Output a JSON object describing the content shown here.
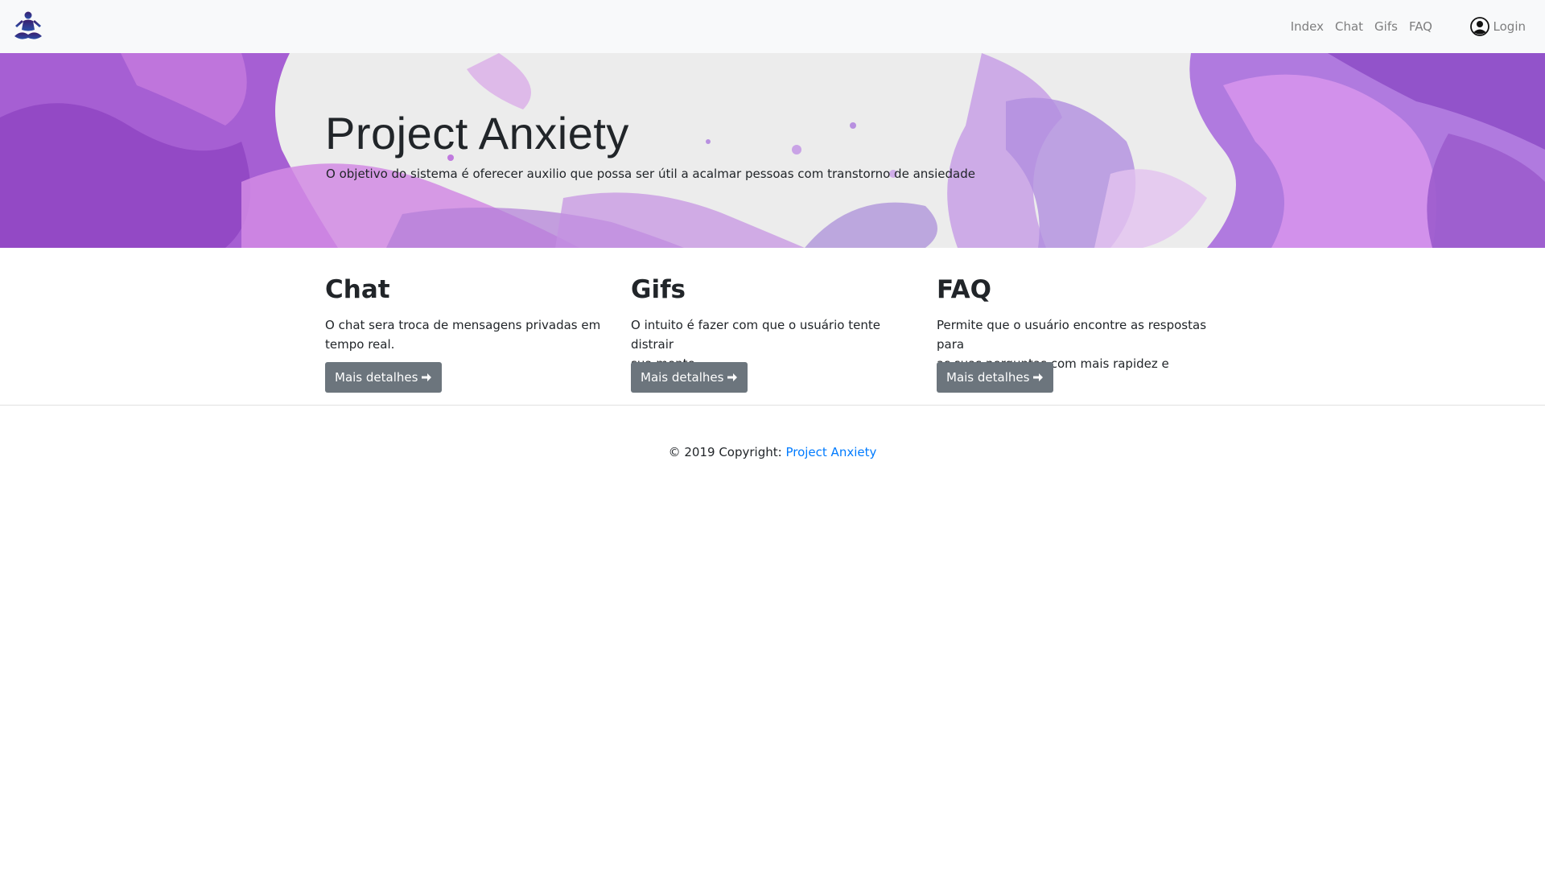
{
  "navbar": {
    "brand_icon": "meditation-person-icon",
    "links": [
      "Index",
      "Chat",
      "Gifs",
      "FAQ"
    ],
    "login_label": "Login",
    "login_icon": "user-circle-icon"
  },
  "hero": {
    "title": "Project Anxiety",
    "lead": "O objetivo do sistema é oferecer auxilio que possa ser útil a acalmar pessoas com transtorno de ansiedade",
    "palette": [
      "#9b59d0",
      "#c66ce0",
      "#b48ee0",
      "#d9a7ea"
    ]
  },
  "features": [
    {
      "title": "Chat",
      "text_line1": "O chat sera troca de mensagens privadas em",
      "text_line2": "tempo real.",
      "button": "Mais detalhes"
    },
    {
      "title": "Gifs",
      "text_line1": "O intuito é fazer com que o usuário tente distrair",
      "text_line2": "sua mente.",
      "button": "Mais detalhes"
    },
    {
      "title": "FAQ",
      "text_line1": "Permite que o usuário encontre as respostas para",
      "text_line2": "as suas perguntas com mais rapidez e facilidade.",
      "button": "Mais detalhes"
    }
  ],
  "footer": {
    "copyright": "© 2019 Copyright:",
    "link": "Project Anxiety"
  },
  "colors": {
    "button": "#6c757d",
    "link": "#007bff",
    "navbar_bg": "#f8f9fa"
  }
}
